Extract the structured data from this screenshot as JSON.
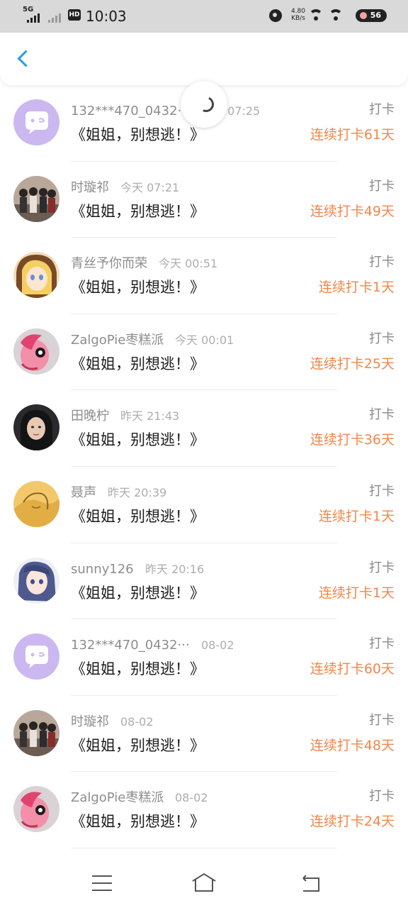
{
  "status_bar": {
    "network": "5G",
    "hd": "HD",
    "time": "10:03",
    "speed_value": "4.80",
    "speed_unit": "KB/s",
    "battery": "56"
  },
  "colors": {
    "accent": "#2c9be6",
    "streak": "#f0874a",
    "username": "#8d8d8d"
  },
  "entries": [
    {
      "username": "132***470_0432···",
      "time": "今天 07:25",
      "title": "《姐姐，别想逃！》",
      "action": "打卡",
      "streak": "连续打卡61天",
      "avatar": "default-chat-avatar"
    },
    {
      "username": "时璇祁",
      "time": "今天 07:21",
      "title": "《姐姐，别想逃！》",
      "action": "打卡",
      "streak": "连续打卡49天",
      "avatar": "group-photo-avatar"
    },
    {
      "username": "青丝予你而荣",
      "time": "今天 00:51",
      "title": "《姐姐，别想逃！》",
      "action": "打卡",
      "streak": "连续打卡1天",
      "avatar": "anime-blonde-avatar"
    },
    {
      "username": "ZalgoPie枣糕派",
      "time": "今天 00:01",
      "title": "《姐姐，别想逃！》",
      "action": "打卡",
      "streak": "连续打卡25天",
      "avatar": "pink-pony-avatar"
    },
    {
      "username": "田晚柠",
      "time": "昨天 21:43",
      "title": "《姐姐，别想逃！》",
      "action": "打卡",
      "streak": "连续打卡36天",
      "avatar": "portrait-avatar"
    },
    {
      "username": "聂声",
      "time": "昨天 20:39",
      "title": "《姐姐，别想逃！》",
      "action": "打卡",
      "streak": "连续打卡1天",
      "avatar": "yellow-sketch-avatar"
    },
    {
      "username": "sunny126",
      "time": "昨天 20:16",
      "title": "《姐姐，别想逃！》",
      "action": "打卡",
      "streak": "连续打卡1天",
      "avatar": "anime-blue-hair-avatar"
    },
    {
      "username": "132***470_0432···",
      "time": "08-02",
      "title": "《姐姐，别想逃！》",
      "action": "打卡",
      "streak": "连续打卡60天",
      "avatar": "default-chat-avatar"
    },
    {
      "username": "时璇祁",
      "time": "08-02",
      "title": "《姐姐，别想逃！》",
      "action": "打卡",
      "streak": "连续打卡48天",
      "avatar": "group-photo-avatar"
    },
    {
      "username": "ZalgoPie枣糕派",
      "time": "08-02",
      "title": "《姐姐，别想逃！》",
      "action": "打卡",
      "streak": "连续打卡24天",
      "avatar": "pink-pony-avatar"
    }
  ]
}
